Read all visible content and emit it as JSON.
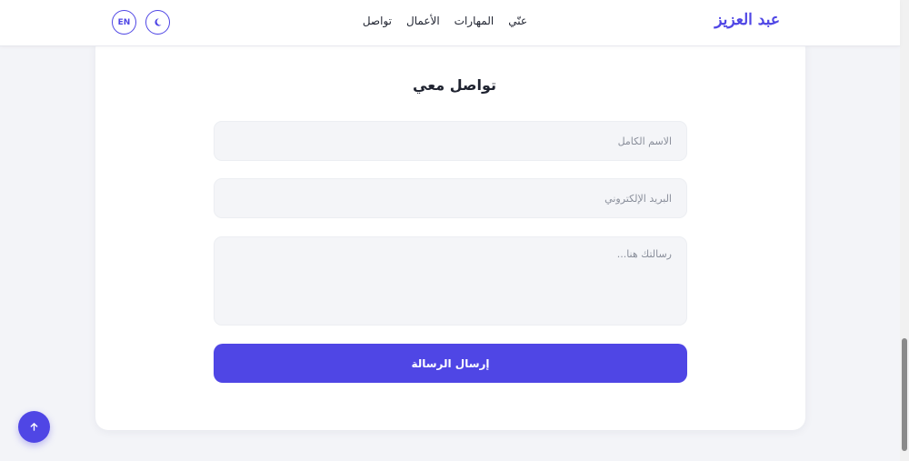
{
  "header": {
    "brand": "عبد العزيز",
    "nav": [
      {
        "label": "عنّي"
      },
      {
        "label": "المهارات"
      },
      {
        "label": "الأعمال"
      },
      {
        "label": "تواصل"
      }
    ],
    "lang_toggle": "EN",
    "theme_icon": "moon-icon"
  },
  "contact": {
    "title": "تواصل معي",
    "name_placeholder": "الاسم الكامل",
    "email_placeholder": "البريد الإلكتروني",
    "message_placeholder": "رسالتك هنا...",
    "submit_label": "إرسال الرسالة"
  },
  "scroll_top_icon": "arrow-up-icon",
  "colors": {
    "accent": "#4f46e5",
    "background": "#f3f4f8",
    "card": "#ffffff",
    "input_bg": "#f4f5f8"
  }
}
